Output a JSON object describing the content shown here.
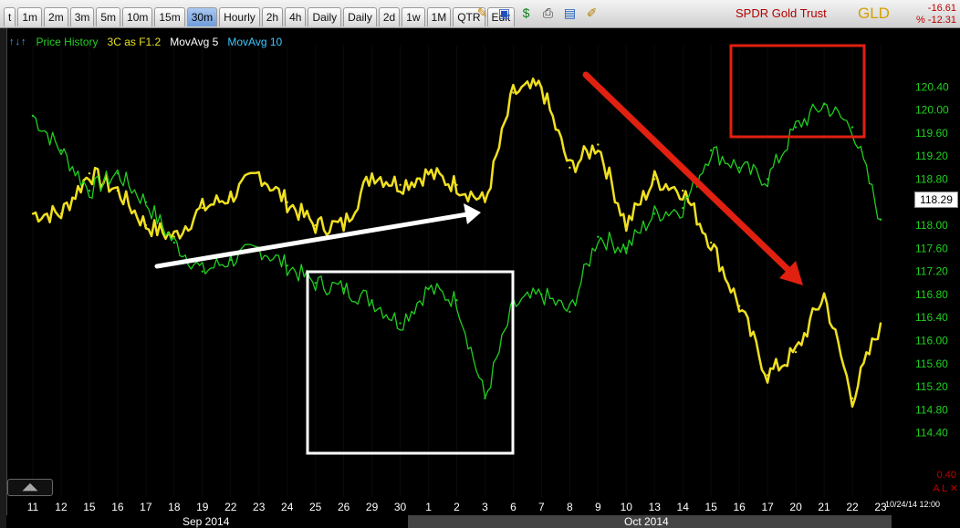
{
  "toolbar": {
    "tabs": [
      "t",
      "1m",
      "2m",
      "3m",
      "5m",
      "10m",
      "15m",
      "30m",
      "Hourly",
      "2h",
      "4h",
      "Daily",
      "Daily",
      "2d",
      "1w",
      "1M",
      "QTR",
      "Edit"
    ],
    "active_tab": "30m",
    "icons": [
      "pencil-icon",
      "save-icon",
      "dollar-icon",
      "print-icon",
      "tape-icon",
      "pen-icon"
    ]
  },
  "header": {
    "symbol_name": "SPDR Gold Trust",
    "symbol_ticker": "GLD",
    "change_abs": "-16.61",
    "change_pct": "% -12.31"
  },
  "legend": {
    "arrows": "↑↓↑",
    "items": [
      {
        "label": "Price History",
        "color": "#20d020"
      },
      {
        "label": "3C as F1.2",
        "color": "#e8e020"
      },
      {
        "label": "MovAvg 5",
        "color": "#ffffff"
      },
      {
        "label": "MovAvg 10",
        "color": "#40c8ff"
      }
    ]
  },
  "price_box": "118.29",
  "extra_value": "0.40",
  "extra_tag": "A L ✕",
  "date_label": "10/24/14 12:00",
  "months": {
    "first": "Sep 2014",
    "second": "Oct 2014"
  },
  "colors": {
    "price": "#20d020",
    "indicator": "#f0e020",
    "background": "#000000",
    "white_annotation": "#ffffff",
    "red_annotation": "#e02010"
  },
  "chart_data": {
    "type": "line",
    "x": [
      "11",
      "12",
      "15",
      "16",
      "17",
      "18",
      "19",
      "22",
      "23",
      "24",
      "25",
      "26",
      "29",
      "30",
      "1",
      "2",
      "3",
      "6",
      "7",
      "8",
      "9",
      "10",
      "13",
      "14",
      "15",
      "16",
      "17",
      "20",
      "21",
      "22",
      "23"
    ],
    "ylim": [
      114.0,
      120.8
    ],
    "y_ticks": [
      "120.40",
      "120.00",
      "119.60",
      "119.20",
      "118.80",
      "118.40",
      "118.00",
      "117.60",
      "117.20",
      "116.80",
      "116.40",
      "116.00",
      "115.60",
      "115.20",
      "114.80",
      "114.40"
    ],
    "series": [
      {
        "name": "Price History",
        "values": [
          119.9,
          119.3,
          118.6,
          118.9,
          118.4,
          117.7,
          117.2,
          117.4,
          117.6,
          117.3,
          117.0,
          116.9,
          116.7,
          116.3,
          116.9,
          116.7,
          115.0,
          116.6,
          116.8,
          116.5,
          117.8,
          117.6,
          118.2,
          118.3,
          119.3,
          119.0,
          118.8,
          119.7,
          120.1,
          119.7,
          118.1
        ]
      },
      {
        "name": "3C as F1.2",
        "values": [
          118.2,
          118.2,
          118.9,
          118.6,
          118.0,
          117.8,
          118.3,
          118.5,
          118.9,
          118.4,
          118.0,
          118.0,
          118.9,
          118.7,
          118.9,
          118.7,
          118.4,
          120.3,
          120.4,
          119.0,
          119.4,
          118.0,
          118.8,
          118.6,
          117.7,
          116.6,
          115.4,
          115.8,
          116.8,
          115.0,
          116.3
        ]
      }
    ]
  }
}
